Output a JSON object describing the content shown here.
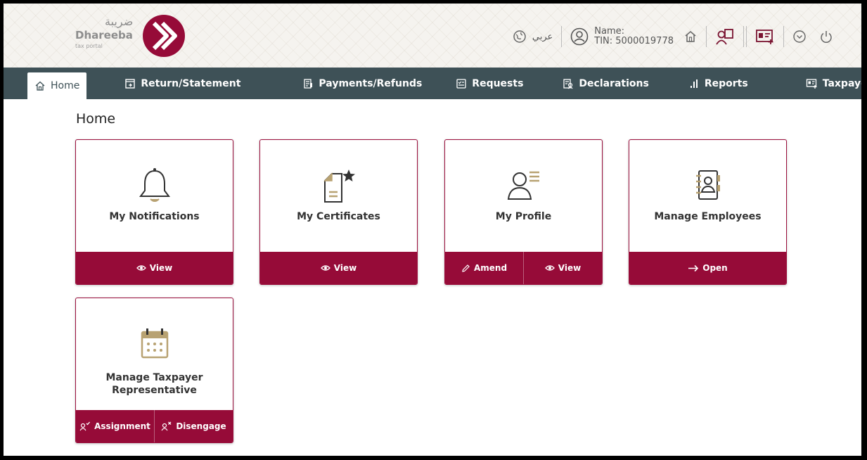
{
  "header": {
    "logo_arabic": "ضريبة",
    "logo_name": "Dhareeba",
    "logo_sub": "tax portal",
    "language_label": "عربي",
    "name_label": "Name:",
    "tin_label": "TIN: 5000019778"
  },
  "nav": {
    "items": [
      {
        "label": "Home",
        "icon": "home-icon"
      },
      {
        "label": "Return/Statement",
        "icon": "return-icon"
      },
      {
        "label": "Payments/Refunds",
        "icon": "payments-icon"
      },
      {
        "label": "Requests",
        "icon": "requests-icon"
      },
      {
        "label": "Declarations",
        "icon": "declarations-icon"
      },
      {
        "label": "Reports",
        "icon": "reports-icon"
      },
      {
        "label": "Taxpayer Services",
        "icon": "services-icon"
      }
    ]
  },
  "page": {
    "title": "Home"
  },
  "cards": [
    {
      "title": "My Notifications",
      "icon": "bell-icon",
      "actions": [
        {
          "label": "View",
          "icon": "eye-icon"
        }
      ]
    },
    {
      "title": "My Certificates",
      "icon": "certificate-icon",
      "actions": [
        {
          "label": "View",
          "icon": "eye-icon"
        }
      ]
    },
    {
      "title": "My Profile",
      "icon": "profile-icon",
      "actions": [
        {
          "label": "Amend",
          "icon": "pencil-icon"
        },
        {
          "label": "View",
          "icon": "eye-icon"
        }
      ]
    },
    {
      "title": "Manage Employees",
      "icon": "contacts-book-icon",
      "actions": [
        {
          "label": "Open",
          "icon": "arrow-right-icon"
        }
      ]
    },
    {
      "title_line1": "Manage Taxpayer",
      "title_line2": "Representative",
      "icon": "calendar-icon",
      "actions": [
        {
          "label": "Assignment",
          "icon": "user-check-icon"
        },
        {
          "label": "Disengage",
          "icon": "user-x-icon"
        }
      ]
    }
  ],
  "colors": {
    "brand": "#960b38",
    "nav_bg": "#3e5157",
    "icon_gold": "#b8a272"
  }
}
